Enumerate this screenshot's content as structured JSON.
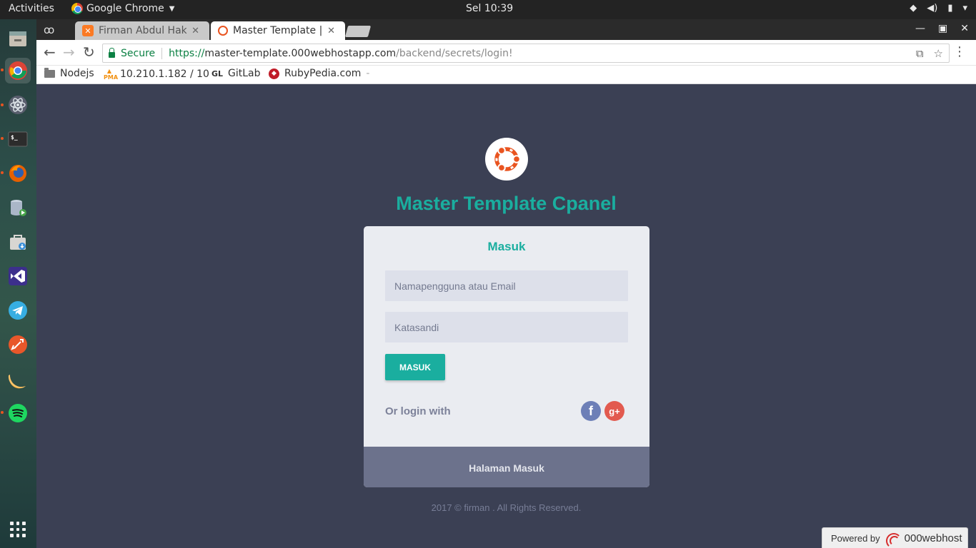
{
  "topbar": {
    "activities": "Activities",
    "app_name": "Google Chrome",
    "clock": "Sel 10:39"
  },
  "dock": {
    "items": [
      "files",
      "chrome",
      "atom",
      "terminal",
      "firefox",
      "database-manager",
      "software-store",
      "visual-studio-code",
      "telegram",
      "rocket-app",
      "orange-app",
      "spotify"
    ],
    "accent": "#e95420"
  },
  "browser": {
    "tabs": [
      {
        "title": "Firman Abdul Hakim",
        "favicon": "xampp-icon",
        "active": false
      },
      {
        "title": "Master Template | H",
        "favicon": "ubuntu-icon",
        "active": true
      }
    ],
    "address": {
      "secure_label": "Secure",
      "url_scheme": "https://",
      "url_host": "master-template.000webhostapp.com",
      "url_path": "/backend/secrets/login!"
    },
    "bookmarks": [
      {
        "label": "Nodejs",
        "icon": "folder-icon"
      },
      {
        "label": "10.210.1.182 / 10",
        "icon": "phpmyadmin-icon"
      },
      {
        "label": "GitLab",
        "icon": "gitlab-icon"
      },
      {
        "label": "RubyPedia.com",
        "icon": "ruby-icon"
      }
    ]
  },
  "page": {
    "site_title": "Master Template Cpanel",
    "card": {
      "title": "Masuk",
      "username_placeholder": "Namapengguna atau Email",
      "password_placeholder": "Katasandi",
      "submit_label": "MASUK",
      "or_login_with": "Or login with",
      "social": [
        "facebook",
        "google-plus"
      ],
      "footer": "Halaman Masuk"
    },
    "copyright": "2017 © firman . All Rights Reserved.",
    "powered": {
      "label": "Powered by",
      "brand": "000webhost"
    },
    "colors": {
      "accent": "#1aae9f",
      "background": "#3b4054",
      "card": "#eaecf1",
      "card_footer": "#6c728c"
    }
  }
}
